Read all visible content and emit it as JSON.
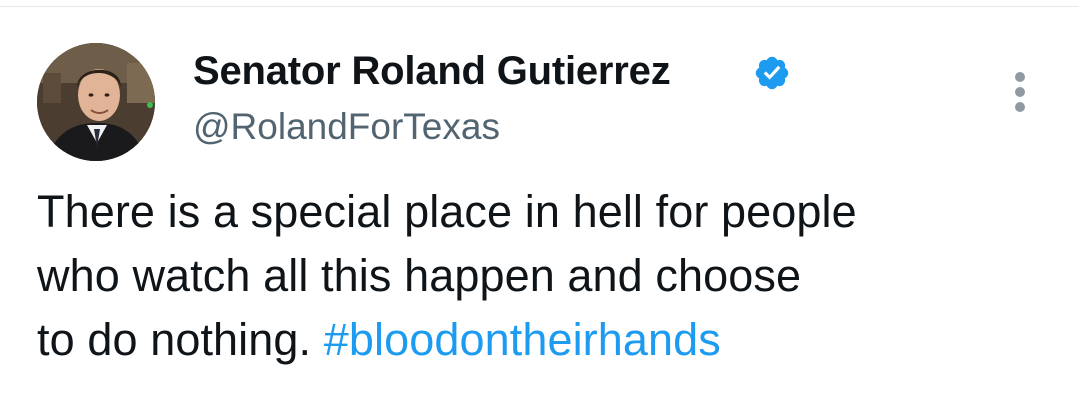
{
  "tweet": {
    "author": {
      "display_name": "Senator Roland Gutierrez",
      "handle": "@RolandForTexas",
      "verified": true
    },
    "text_lines": [
      "There is a special place in hell for people",
      "who watch all this happen and choose",
      "to do nothing."
    ],
    "hashtag": "#bloodontheirhands"
  },
  "icons": {
    "verified": "verified-badge-icon",
    "more": "more-options-icon"
  },
  "colors": {
    "verified_badge": "#1d9bf0",
    "hashtag": "#1d9bf0",
    "handle": "#536471",
    "text": "#0f1419",
    "more_dots": "#8f9aa3"
  }
}
